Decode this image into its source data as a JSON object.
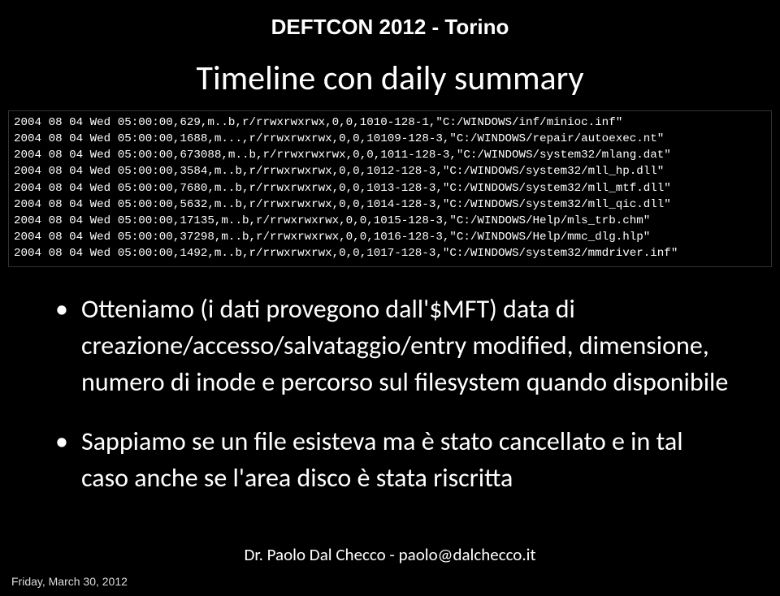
{
  "header": "DEFTCON 2012 - Torino",
  "title": "Timeline con daily summary",
  "terminal": {
    "lines": [
      "2004 08 04 Wed 05:00:00,629,m..b,r/rrwxrwxrwx,0,0,1010-128-1,\"C:/WINDOWS/inf/minioc.inf\"",
      "2004 08 04 Wed 05:00:00,1688,m...,r/rrwxrwxrwx,0,0,10109-128-3,\"C:/WINDOWS/repair/autoexec.nt\"",
      "2004 08 04 Wed 05:00:00,673088,m..b,r/rrwxrwxrwx,0,0,1011-128-3,\"C:/WINDOWS/system32/mlang.dat\"",
      "2004 08 04 Wed 05:00:00,3584,m..b,r/rrwxrwxrwx,0,0,1012-128-3,\"C:/WINDOWS/system32/mll_hp.dll\"",
      "2004 08 04 Wed 05:00:00,7680,m..b,r/rrwxrwxrwx,0,0,1013-128-3,\"C:/WINDOWS/system32/mll_mtf.dll\"",
      "2004 08 04 Wed 05:00:00,5632,m..b,r/rrwxrwxrwx,0,0,1014-128-3,\"C:/WINDOWS/system32/mll_qic.dll\"",
      "2004 08 04 Wed 05:00:00,17135,m..b,r/rrwxrwxrwx,0,0,1015-128-3,\"C:/WINDOWS/Help/mls_trb.chm\"",
      "2004 08 04 Wed 05:00:00,37298,m..b,r/rrwxrwxrwx,0,0,1016-128-3,\"C:/WINDOWS/Help/mmc_dlg.hlp\"",
      "2004 08 04 Wed 05:00:00,1492,m..b,r/rrwxrwxrwx,0,0,1017-128-3,\"C:/WINDOWS/system32/mmdriver.inf\""
    ]
  },
  "bullets": [
    "Otteniamo (i dati provegono dall'$MFT) data di creazione/accesso/salvataggio/entry modified, dimensione, numero di inode e percorso sul filesystem quando disponibile",
    "Sappiamo se un file esisteva ma è stato cancellato e in tal caso anche se l'area disco è stata riscritta"
  ],
  "footer": "Dr. Paolo Dal Checco - paolo@dalchecco.it",
  "date": "Friday, March 30, 2012"
}
